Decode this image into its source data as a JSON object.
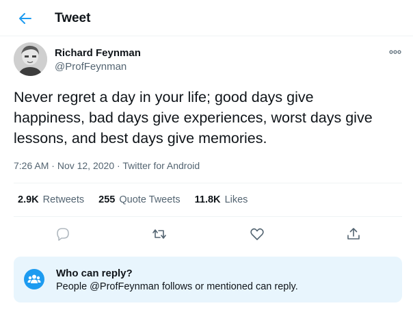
{
  "header": {
    "title": "Tweet"
  },
  "author": {
    "name": "Richard Feynman",
    "handle": "@ProfFeynman"
  },
  "tweet": {
    "text_lines": [
      "Never regret a day in your life; good days give",
      "happiness, bad days give experiences, worst days give",
      "lessons, and best days give memories."
    ]
  },
  "meta": {
    "time": "7:26 AM",
    "date": "Nov 12, 2020",
    "source": "Twitter for Android",
    "separator": "·"
  },
  "stats": {
    "retweets_count": "2.9K",
    "retweets_label": "Retweets",
    "quotes_count": "255",
    "quotes_label": "Quote Tweets",
    "likes_count": "11.8K",
    "likes_label": "Likes"
  },
  "reply_settings": {
    "title": "Who can reply?",
    "description": "People @ProfFeynman follows or mentioned can reply."
  },
  "colors": {
    "accent": "#1d9bf0",
    "text": "#0f1419",
    "secondary": "#536471",
    "reply_bg": "#e8f5fd"
  }
}
